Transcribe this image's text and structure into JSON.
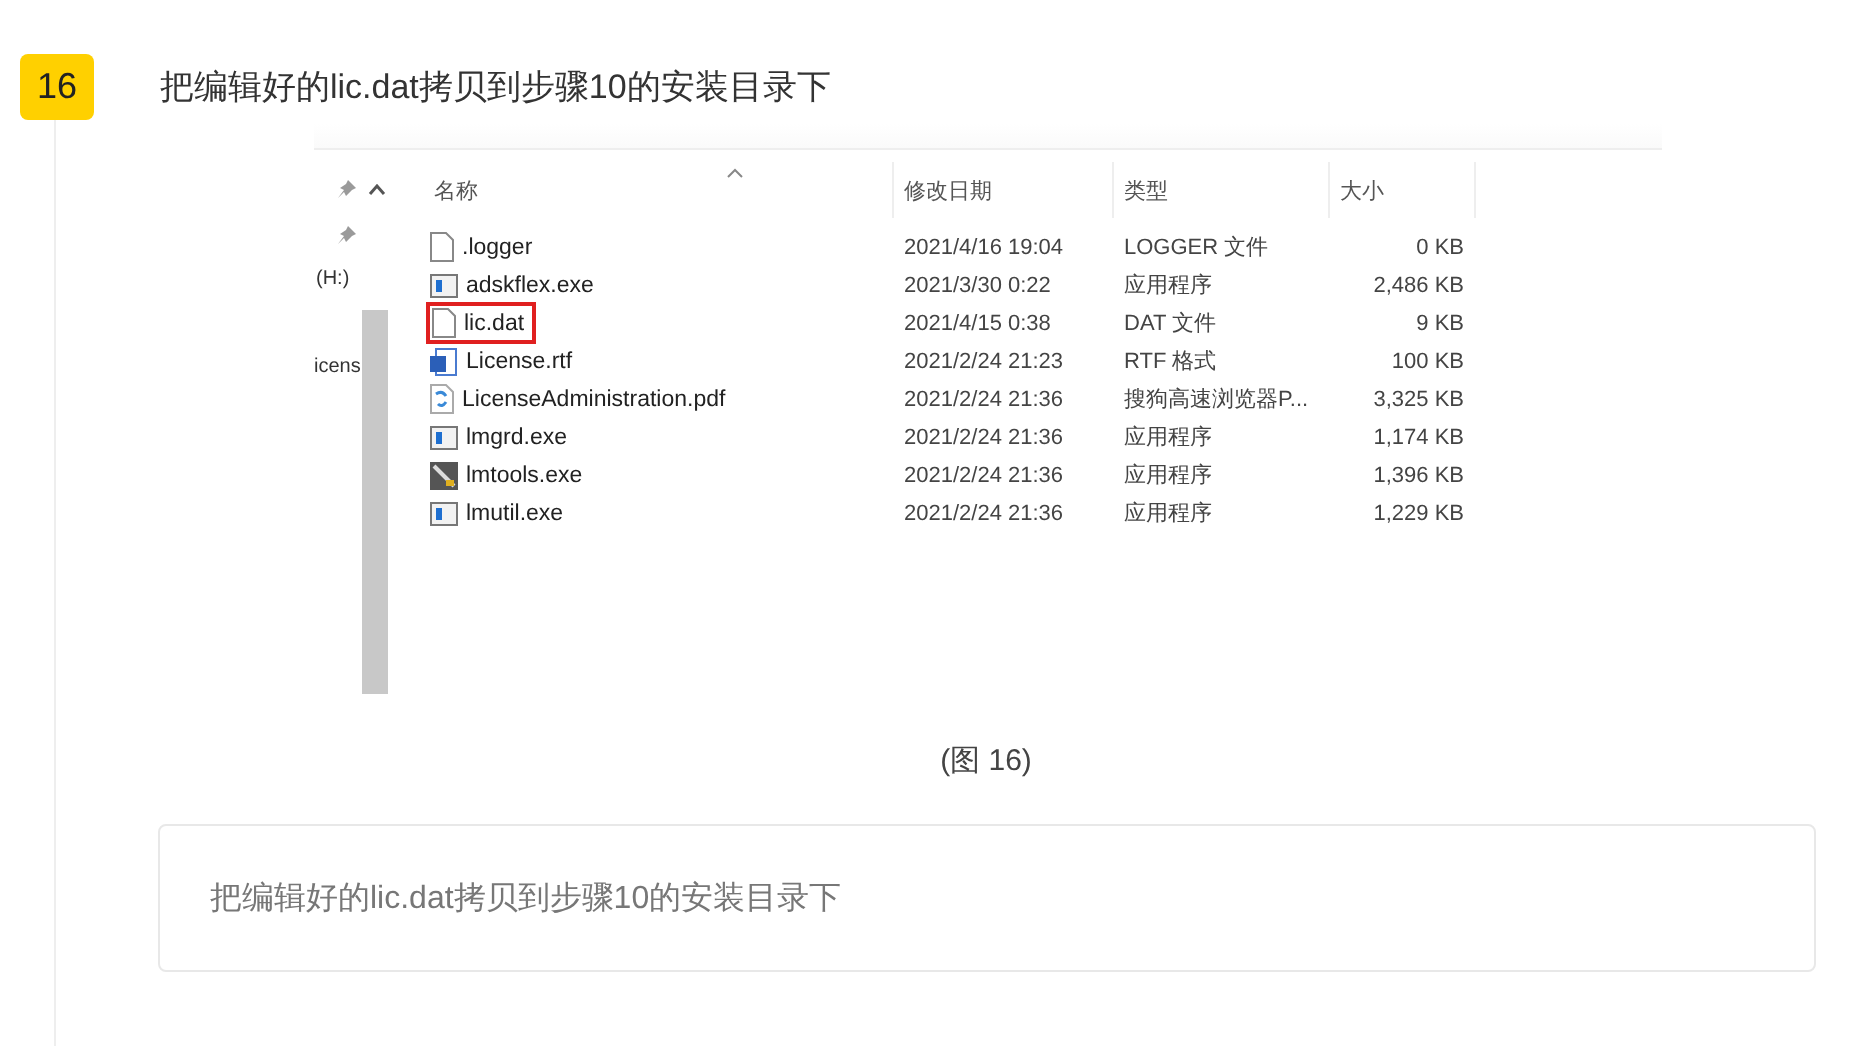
{
  "step": {
    "number": "16",
    "title": "把编辑好的lic.dat拷贝到步骤10的安装目录下"
  },
  "screenshot": {
    "nav_items": [
      "(H:)",
      "icens"
    ],
    "columns": [
      "名称",
      "修改日期",
      "类型",
      "大小"
    ],
    "files": [
      {
        "name": ".logger",
        "date": "2021/4/16 19:04",
        "type": "LOGGER 文件",
        "size": "0 KB",
        "kind": "file",
        "highlighted": false
      },
      {
        "name": "adskflex.exe",
        "date": "2021/3/30 0:22",
        "type": "应用程序",
        "size": "2,486 KB",
        "kind": "exe",
        "highlighted": false
      },
      {
        "name": "lic.dat",
        "date": "2021/4/15 0:38",
        "type": "DAT 文件",
        "size": "9 KB",
        "kind": "file",
        "highlighted": true
      },
      {
        "name": "License.rtf",
        "date": "2021/2/24 21:23",
        "type": "RTF 格式",
        "size": "100 KB",
        "kind": "rtf",
        "highlighted": false
      },
      {
        "name": "LicenseAdministration.pdf",
        "date": "2021/2/24 21:36",
        "type": "搜狗高速浏览器P...",
        "size": "3,325 KB",
        "kind": "pdf",
        "highlighted": false
      },
      {
        "name": "lmgrd.exe",
        "date": "2021/2/24 21:36",
        "type": "应用程序",
        "size": "1,174 KB",
        "kind": "exe",
        "highlighted": false
      },
      {
        "name": "lmtools.exe",
        "date": "2021/2/24 21:36",
        "type": "应用程序",
        "size": "1,396 KB",
        "kind": "tool",
        "highlighted": false
      },
      {
        "name": "lmutil.exe",
        "date": "2021/2/24 21:36",
        "type": "应用程序",
        "size": "1,229 KB",
        "kind": "exe",
        "highlighted": false
      }
    ]
  },
  "caption": "(图 16)",
  "note": "把编辑好的lic.dat拷贝到步骤10的安装目录下"
}
